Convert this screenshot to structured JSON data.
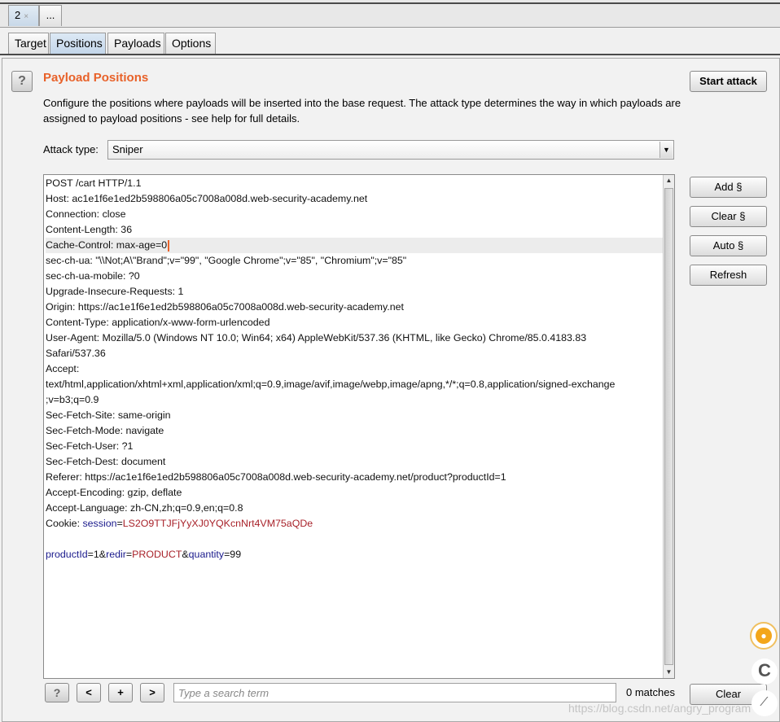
{
  "intruder_tabs": {
    "active_num": "2",
    "close_glyph": "×",
    "more": "..."
  },
  "sub_tabs": [
    "Target",
    "Positions",
    "Payloads",
    "Options"
  ],
  "section": {
    "help": "?",
    "title": "Payload Positions",
    "description": "Configure the positions where payloads will be inserted into the base request. The attack type determines the way in which payloads are assigned to payload positions - see help for full details.",
    "start_attack": "Start attack",
    "attack_type_label": "Attack type:",
    "attack_type_value": "Sniper"
  },
  "side_buttons": [
    "Add §",
    "Clear §",
    "Auto §",
    "Refresh"
  ],
  "request_lines": [
    {
      "text": "POST /cart HTTP/1.1"
    },
    {
      "text": "Host: ac1e1f6e1ed2b598806a05c7008a008d.web-security-academy.net"
    },
    {
      "text": "Connection: close"
    },
    {
      "text": "Content-Length: 36"
    },
    {
      "text": "Cache-Control: max-age=0",
      "caret": true,
      "highlight": true
    },
    {
      "text": "sec-ch-ua: \"\\\\Not;A\\\"Brand\";v=\"99\", \"Google Chrome\";v=\"85\", \"Chromium\";v=\"85\""
    },
    {
      "text": "sec-ch-ua-mobile: ?0"
    },
    {
      "text": "Upgrade-Insecure-Requests: 1"
    },
    {
      "text": "Origin: https://ac1e1f6e1ed2b598806a05c7008a008d.web-security-academy.net"
    },
    {
      "text": "Content-Type: application/x-www-form-urlencoded"
    },
    {
      "text": "User-Agent: Mozilla/5.0 (Windows NT 10.0; Win64; x64) AppleWebKit/537.36 (KHTML, like Gecko) Chrome/85.0.4183.83"
    },
    {
      "text": "Safari/537.36"
    },
    {
      "text": "Accept:"
    },
    {
      "text": "text/html,application/xhtml+xml,application/xml;q=0.9,image/avif,image/webp,image/apng,*/*;q=0.8,application/signed-exchange"
    },
    {
      "text": ";v=b3;q=0.9"
    },
    {
      "text": "Sec-Fetch-Site: same-origin"
    },
    {
      "text": "Sec-Fetch-Mode: navigate"
    },
    {
      "text": "Sec-Fetch-User: ?1"
    },
    {
      "text": "Sec-Fetch-Dest: document"
    },
    {
      "text": "Referer: https://ac1e1f6e1ed2b598806a05c7008a008d.web-security-academy.net/product?productId=1"
    },
    {
      "text": "Accept-Encoding: gzip, deflate"
    },
    {
      "text": "Accept-Language: zh-CN,zh;q=0.9,en;q=0.8"
    },
    {
      "segments": [
        {
          "t": "Cookie: ",
          "c": ""
        },
        {
          "t": "session",
          "c": "k"
        },
        {
          "t": "=",
          "c": ""
        },
        {
          "t": "LS2O9TTJFjYyXJ0YQKcnNrt4VM75aQDe",
          "c": "v"
        }
      ]
    },
    {
      "text": ""
    },
    {
      "segments": [
        {
          "t": "productId",
          "c": "k"
        },
        {
          "t": "=1&",
          "c": ""
        },
        {
          "t": "redir",
          "c": "k"
        },
        {
          "t": "=",
          "c": ""
        },
        {
          "t": "PRODUCT",
          "c": "v"
        },
        {
          "t": "&",
          "c": ""
        },
        {
          "t": "quantity",
          "c": "k"
        },
        {
          "t": "=99",
          "c": ""
        }
      ]
    }
  ],
  "bottom_bar": {
    "help": "?",
    "prev": "<",
    "add": "+",
    "next": ">",
    "search_placeholder": "Type a search term",
    "matches": "0 matches",
    "clear": "Clear"
  },
  "watermark": "https://blog.csdn.net/angry_program"
}
